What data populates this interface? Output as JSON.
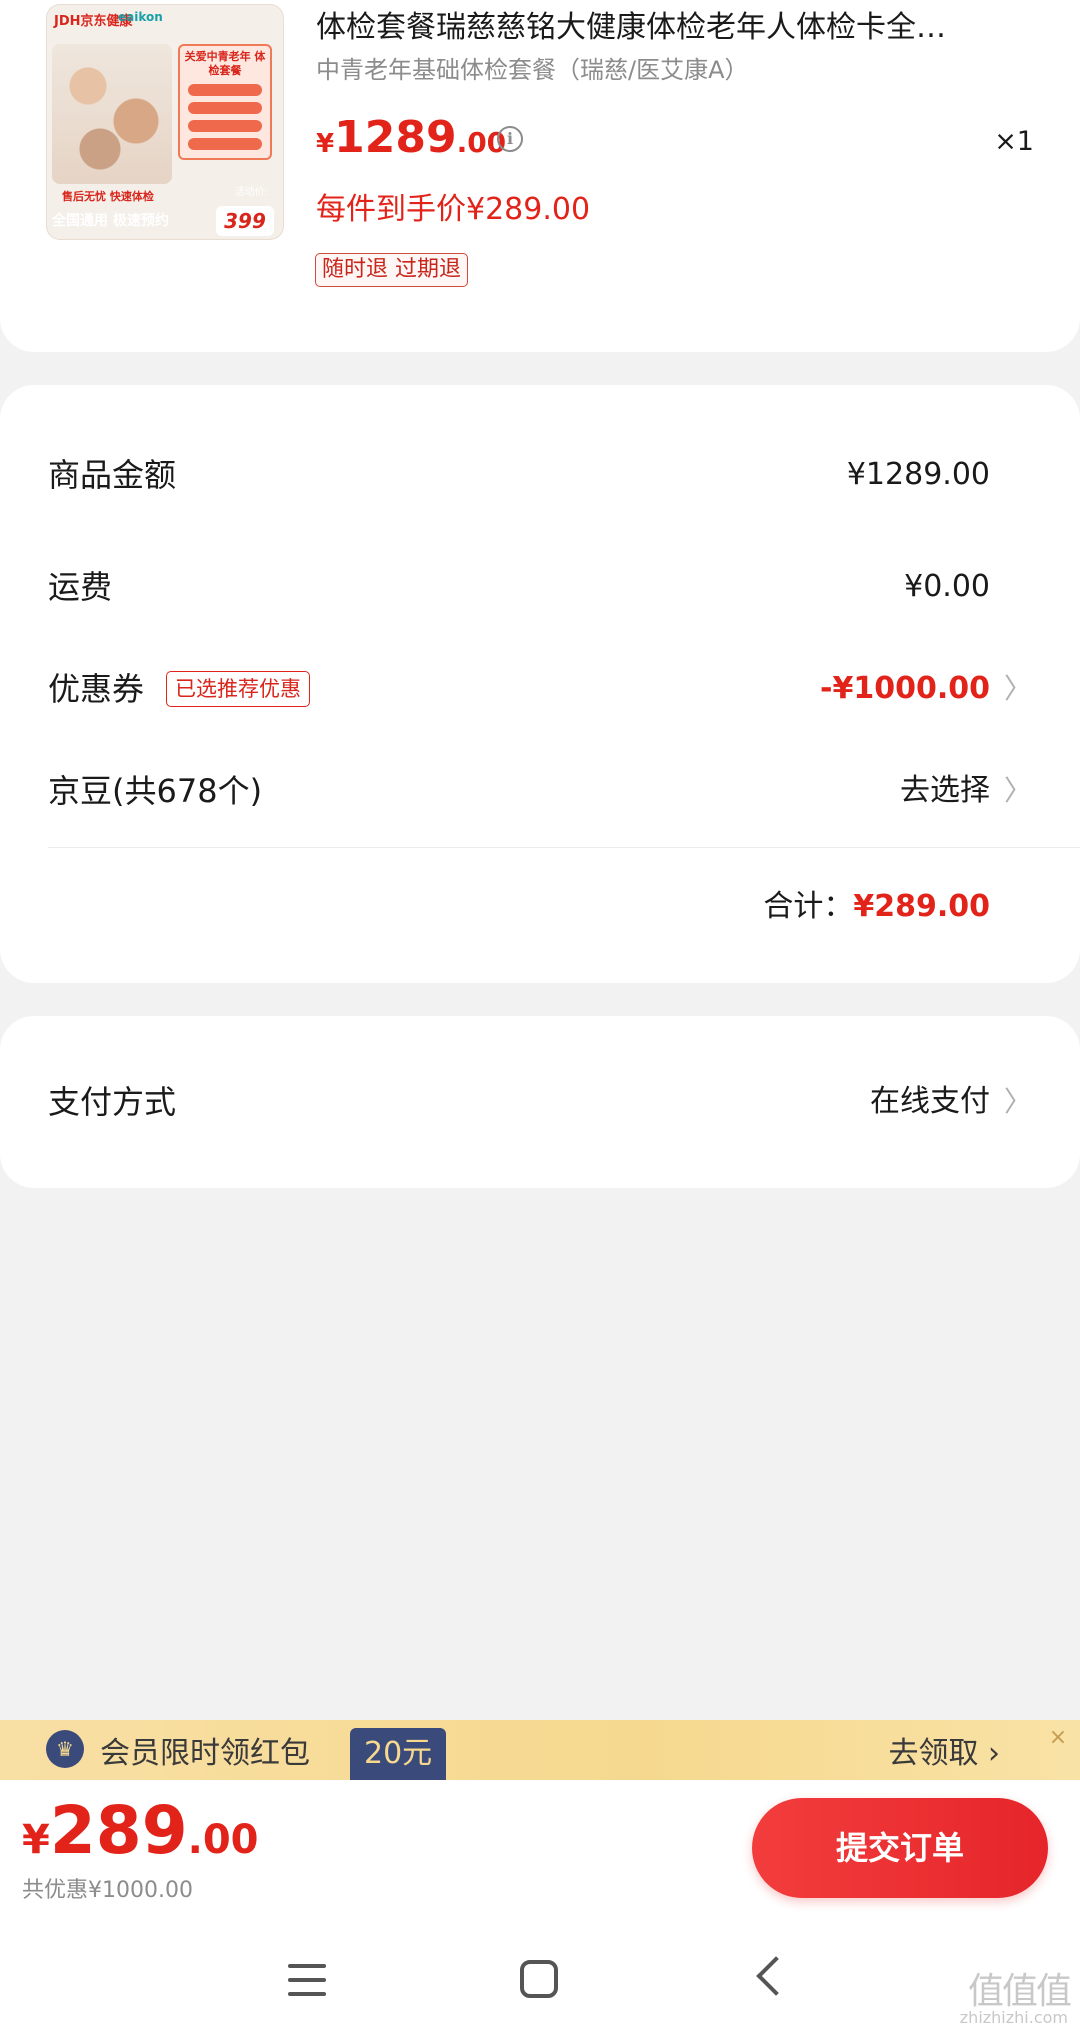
{
  "product": {
    "title": "体检套餐瑞慈慈铭大健康体检老年人体检卡全…",
    "subtitle": "中青老年基础体检套餐（瑞慈/医艾康A）",
    "price_currency": "¥",
    "price_int": "1289",
    "price_dec": ".00",
    "quantity": "×1",
    "each_price": "每件到手价¥289.00",
    "refund_tag": "随时退 过期退",
    "image": {
      "brand": "JDH京东健康",
      "brand2": "eaikon",
      "tag_title": "关爱中青老年 体检套餐",
      "bar_text1": "售后无忧 快速体检",
      "bar_text2": "全国通用 极速预约",
      "promo_label": "活动价:",
      "promo_price": "399"
    }
  },
  "summary": {
    "goods_label": "商品金额",
    "goods_value": "¥1289.00",
    "shipping_label": "运费",
    "shipping_value": "¥0.00",
    "coupon_label": "优惠券",
    "coupon_badge": "已选推荐优惠",
    "coupon_value": "-¥1000.00",
    "beans_label": "京豆(共678个)",
    "beans_value": "去选择",
    "total_label": "合计：",
    "total_value": "¥289.00"
  },
  "payment": {
    "label": "支付方式",
    "value": "在线支付"
  },
  "banner": {
    "text": "会员限时领红包",
    "amount": "20元",
    "claim": "去领取 ›",
    "close": "×"
  },
  "footer": {
    "currency": "¥",
    "total_int": "289",
    "total_dec": ".00",
    "saved": "共优惠¥1000.00",
    "submit": "提交订单"
  },
  "watermark": {
    "main": "值值值",
    "sub": "zhizhizhi.com"
  },
  "colors": {
    "accent_red": "#e2231a",
    "banner_navy": "#3a4a7a",
    "banner_gold": "#f6d98f"
  }
}
